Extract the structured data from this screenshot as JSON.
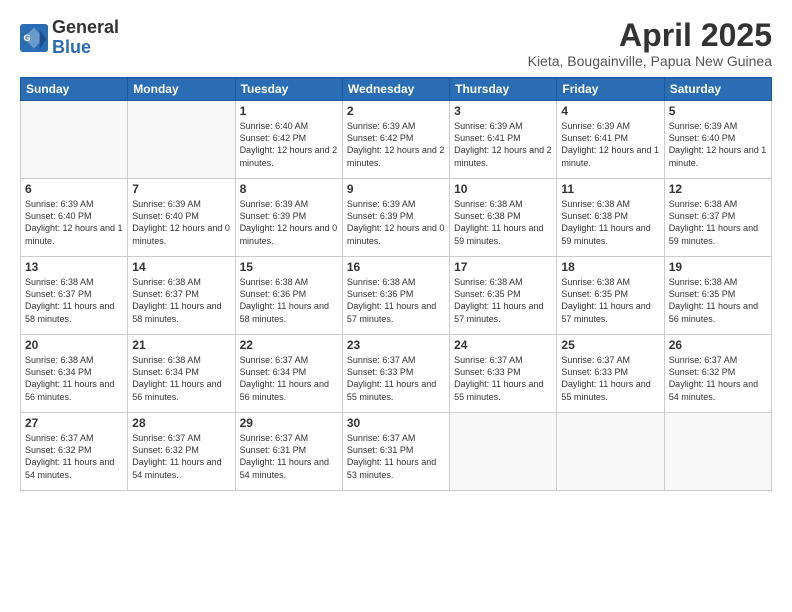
{
  "logo": {
    "general": "General",
    "blue": "Blue"
  },
  "title": "April 2025",
  "location": "Kieta, Bougainville, Papua New Guinea",
  "days_header": [
    "Sunday",
    "Monday",
    "Tuesday",
    "Wednesday",
    "Thursday",
    "Friday",
    "Saturday"
  ],
  "weeks": [
    [
      {
        "day": "",
        "info": ""
      },
      {
        "day": "",
        "info": ""
      },
      {
        "day": "1",
        "info": "Sunrise: 6:40 AM\nSunset: 6:42 PM\nDaylight: 12 hours\nand 2 minutes."
      },
      {
        "day": "2",
        "info": "Sunrise: 6:39 AM\nSunset: 6:42 PM\nDaylight: 12 hours\nand 2 minutes."
      },
      {
        "day": "3",
        "info": "Sunrise: 6:39 AM\nSunset: 6:41 PM\nDaylight: 12 hours\nand 2 minutes."
      },
      {
        "day": "4",
        "info": "Sunrise: 6:39 AM\nSunset: 6:41 PM\nDaylight: 12 hours\nand 1 minute."
      },
      {
        "day": "5",
        "info": "Sunrise: 6:39 AM\nSunset: 6:40 PM\nDaylight: 12 hours\nand 1 minute."
      }
    ],
    [
      {
        "day": "6",
        "info": "Sunrise: 6:39 AM\nSunset: 6:40 PM\nDaylight: 12 hours\nand 1 minute."
      },
      {
        "day": "7",
        "info": "Sunrise: 6:39 AM\nSunset: 6:40 PM\nDaylight: 12 hours\nand 0 minutes."
      },
      {
        "day": "8",
        "info": "Sunrise: 6:39 AM\nSunset: 6:39 PM\nDaylight: 12 hours\nand 0 minutes."
      },
      {
        "day": "9",
        "info": "Sunrise: 6:39 AM\nSunset: 6:39 PM\nDaylight: 12 hours\nand 0 minutes."
      },
      {
        "day": "10",
        "info": "Sunrise: 6:38 AM\nSunset: 6:38 PM\nDaylight: 11 hours\nand 59 minutes."
      },
      {
        "day": "11",
        "info": "Sunrise: 6:38 AM\nSunset: 6:38 PM\nDaylight: 11 hours\nand 59 minutes."
      },
      {
        "day": "12",
        "info": "Sunrise: 6:38 AM\nSunset: 6:37 PM\nDaylight: 11 hours\nand 59 minutes."
      }
    ],
    [
      {
        "day": "13",
        "info": "Sunrise: 6:38 AM\nSunset: 6:37 PM\nDaylight: 11 hours\nand 58 minutes."
      },
      {
        "day": "14",
        "info": "Sunrise: 6:38 AM\nSunset: 6:37 PM\nDaylight: 11 hours\nand 58 minutes."
      },
      {
        "day": "15",
        "info": "Sunrise: 6:38 AM\nSunset: 6:36 PM\nDaylight: 11 hours\nand 58 minutes."
      },
      {
        "day": "16",
        "info": "Sunrise: 6:38 AM\nSunset: 6:36 PM\nDaylight: 11 hours\nand 57 minutes."
      },
      {
        "day": "17",
        "info": "Sunrise: 6:38 AM\nSunset: 6:35 PM\nDaylight: 11 hours\nand 57 minutes."
      },
      {
        "day": "18",
        "info": "Sunrise: 6:38 AM\nSunset: 6:35 PM\nDaylight: 11 hours\nand 57 minutes."
      },
      {
        "day": "19",
        "info": "Sunrise: 6:38 AM\nSunset: 6:35 PM\nDaylight: 11 hours\nand 56 minutes."
      }
    ],
    [
      {
        "day": "20",
        "info": "Sunrise: 6:38 AM\nSunset: 6:34 PM\nDaylight: 11 hours\nand 56 minutes."
      },
      {
        "day": "21",
        "info": "Sunrise: 6:38 AM\nSunset: 6:34 PM\nDaylight: 11 hours\nand 56 minutes."
      },
      {
        "day": "22",
        "info": "Sunrise: 6:37 AM\nSunset: 6:34 PM\nDaylight: 11 hours\nand 56 minutes."
      },
      {
        "day": "23",
        "info": "Sunrise: 6:37 AM\nSunset: 6:33 PM\nDaylight: 11 hours\nand 55 minutes."
      },
      {
        "day": "24",
        "info": "Sunrise: 6:37 AM\nSunset: 6:33 PM\nDaylight: 11 hours\nand 55 minutes."
      },
      {
        "day": "25",
        "info": "Sunrise: 6:37 AM\nSunset: 6:33 PM\nDaylight: 11 hours\nand 55 minutes."
      },
      {
        "day": "26",
        "info": "Sunrise: 6:37 AM\nSunset: 6:32 PM\nDaylight: 11 hours\nand 54 minutes."
      }
    ],
    [
      {
        "day": "27",
        "info": "Sunrise: 6:37 AM\nSunset: 6:32 PM\nDaylight: 11 hours\nand 54 minutes."
      },
      {
        "day": "28",
        "info": "Sunrise: 6:37 AM\nSunset: 6:32 PM\nDaylight: 11 hours\nand 54 minutes."
      },
      {
        "day": "29",
        "info": "Sunrise: 6:37 AM\nSunset: 6:31 PM\nDaylight: 11 hours\nand 54 minutes."
      },
      {
        "day": "30",
        "info": "Sunrise: 6:37 AM\nSunset: 6:31 PM\nDaylight: 11 hours\nand 53 minutes."
      },
      {
        "day": "",
        "info": ""
      },
      {
        "day": "",
        "info": ""
      },
      {
        "day": "",
        "info": ""
      }
    ]
  ]
}
